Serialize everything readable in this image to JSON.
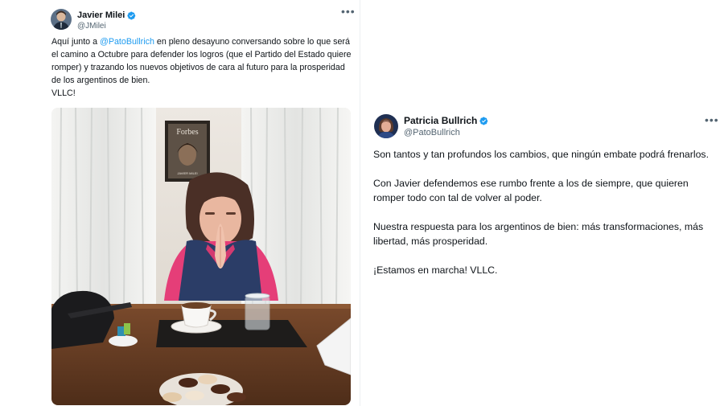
{
  "tweets": [
    {
      "author": {
        "name": "Javier Milei",
        "handle": "@JMilei",
        "verified": true
      },
      "text": {
        "part1": "Aquí junto a ",
        "mention": "@PatoBullrich",
        "part2": " en pleno desayuno conversando sobre lo que será el camino a Octubre para defender los logros (que el Partido del Estado quiere romper) y trazando los nuevos objetivos de cara al futuro para la prosperidad de los argentinos de bien.",
        "part3": "VLLC!"
      },
      "photo": {
        "poster_brand": "Forbes",
        "poster_caption": "JAVIER MILEI"
      },
      "more_icon": "more-horizontal-icon"
    },
    {
      "author": {
        "name": "Patricia Bullrich",
        "handle": "@PatoBullrich",
        "verified": true
      },
      "paragraphs": [
        "Son tantos y tan profundos los cambios, que ningún embate podrá frenarlos.",
        "Con Javier defendemos ese rumbo frente a los de siempre, que quieren romper todo con tal de volver al poder.",
        "Nuestra respuesta para los argentinos de bien: más transformaciones, más libertad, más prosperidad.",
        "¡Estamos en marcha! VLLC."
      ],
      "more_icon": "more-horizontal-icon"
    }
  ],
  "colors": {
    "verified": "#1d9bf0",
    "mention": "#1d9bf0",
    "text": "#0f1419",
    "secondary": "#536471"
  }
}
